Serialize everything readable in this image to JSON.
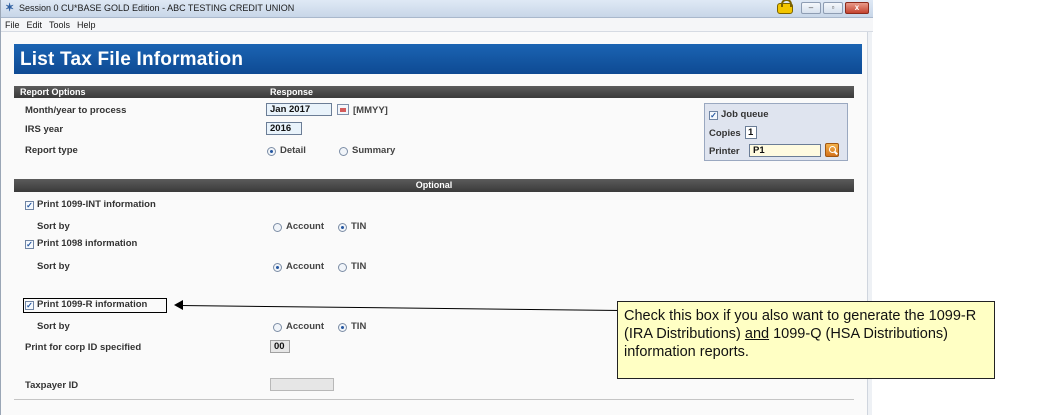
{
  "window": {
    "title": "Session 0 CU*BASE GOLD Edition - ABC TESTING CREDIT UNION",
    "menu": [
      "File",
      "Edit",
      "Tools",
      "Help"
    ]
  },
  "page": {
    "title": "List Tax File Information"
  },
  "report_options": {
    "header_col1": "Report Options",
    "header_col2": "Response",
    "month_year_label": "Month/year to process",
    "month_year_value": "Jan 2017",
    "month_year_format": "[MMYY]",
    "irs_year_label": "IRS year",
    "irs_year_value": "2016",
    "report_type_label": "Report type",
    "report_type_options": [
      "Detail",
      "Summary"
    ],
    "report_type_selected": "Detail"
  },
  "job_queue": {
    "job_queue_label": "Job queue",
    "job_queue_checked": true,
    "copies_label": "Copies",
    "copies_value": "1",
    "printer_label": "Printer",
    "printer_value": "P1"
  },
  "optional": {
    "header": "Optional",
    "print_1099_int": {
      "label": "Print 1099-INT information",
      "checked": true,
      "sort_label": "Sort by",
      "sort_options": [
        "Account",
        "TIN"
      ],
      "sort_selected": "TIN"
    },
    "print_1098": {
      "label": "Print 1098 information",
      "checked": true,
      "sort_label": "Sort by",
      "sort_options": [
        "Account",
        "TIN"
      ],
      "sort_selected": "Account"
    },
    "print_1099_r": {
      "label": "Print 1099-R information",
      "checked": true,
      "sort_label": "Sort by",
      "sort_options": [
        "Account",
        "TIN"
      ],
      "sort_selected": "TIN"
    },
    "corp_id_label": "Print for corp ID specified",
    "corp_id_value": "00",
    "taxpayer_id_label": "Taxpayer ID",
    "taxpayer_id_value": ""
  },
  "callout": {
    "text_1": "Check this box if you also want to generate the 1099-R (IRA Distributions) ",
    "text_and": "and",
    "text_2": " 1099-Q (HSA Distributions) information reports."
  }
}
